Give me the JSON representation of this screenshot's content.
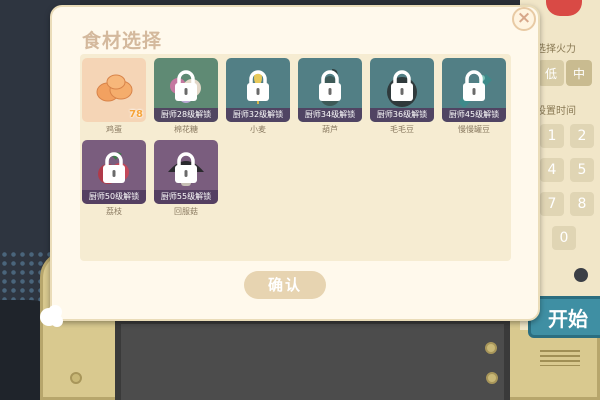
{
  "dialog": {
    "title": "食材选择",
    "close_label": "×",
    "confirm_label": "确认"
  },
  "ingredients": [
    {
      "name": "鸡蛋",
      "locked": false,
      "count": "78",
      "icon": "egg-icon"
    },
    {
      "name": "棉花糖",
      "locked": true,
      "unlock_text": "厨师28级解锁",
      "icon": "marshmallow-icon"
    },
    {
      "name": "小麦",
      "locked": true,
      "unlock_text": "厨师32级解锁",
      "icon": "wheat-icon"
    },
    {
      "name": "葫芦",
      "locked": true,
      "unlock_text": "厨师34级解锁",
      "icon": "gourd-icon"
    },
    {
      "name": "毛毛豆",
      "locked": true,
      "unlock_text": "厨师36级解锁",
      "icon": "edamame-icon"
    },
    {
      "name": "慢慢罐豆",
      "locked": true,
      "unlock_text": "厨师45级解锁",
      "icon": "bean-can-icon"
    },
    {
      "name": "荔枝",
      "locked": true,
      "unlock_text": "厨师50级解锁",
      "icon": "lychee-icon"
    },
    {
      "name": "回服菇",
      "locked": true,
      "unlock_text": "厨师55级解锁",
      "icon": "mushroom-icon"
    }
  ],
  "background": {
    "fire_label": "选择火力",
    "fire_options": [
      "低",
      "中"
    ],
    "time_label": "设置时间",
    "keypad": [
      "1",
      "2",
      "4",
      "5",
      "7",
      "8",
      "0"
    ],
    "start_label": "开始"
  },
  "colors": {
    "dialog_bg": "#fff9ec",
    "panel_bg": "#f6ecd2",
    "title": "#d4b99d",
    "locked_tile": "#527f85",
    "start_button": "#3f8fa3",
    "count_badge": "#f6a43a"
  }
}
